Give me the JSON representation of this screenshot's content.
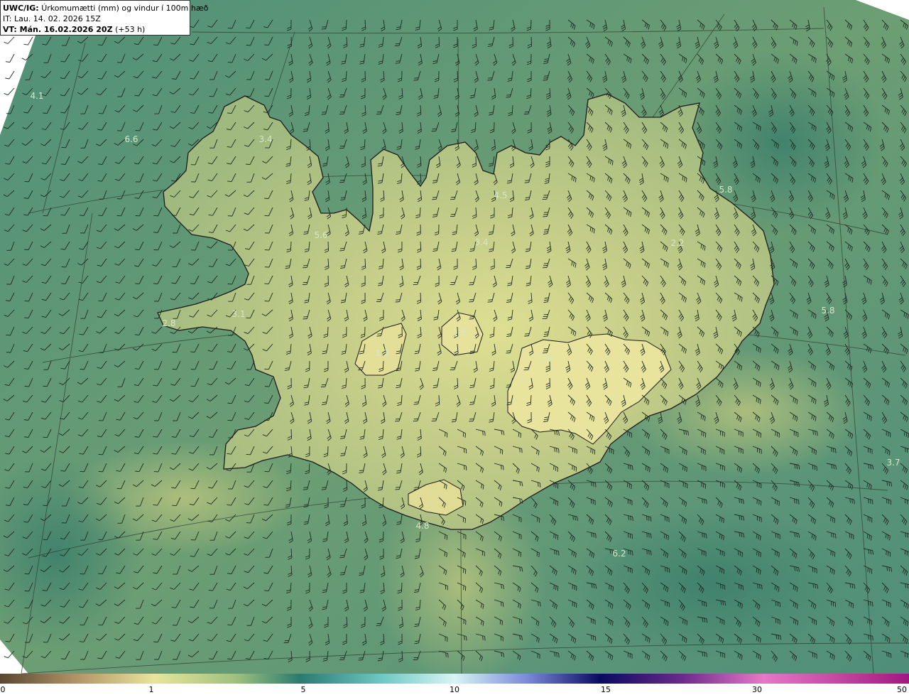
{
  "header": {
    "model": "UWC/IG:",
    "title": "Úrkomumætti (mm) og vindur í 100m hæð",
    "initial_time": "IT: Lau. 14. 02. 2026 15Z",
    "valid_label": "VT: Mán. 16.02.2026 20Z",
    "lead": "(+53 h)"
  },
  "map_labels": [
    {
      "id": "nw-sea-1",
      "text": "4.1"
    },
    {
      "id": "nw-sea-2",
      "text": "6.6"
    },
    {
      "id": "westfjords",
      "text": "3.4"
    },
    {
      "id": "north-west",
      "text": "5.6"
    },
    {
      "id": "north",
      "text": "4.5"
    },
    {
      "id": "north-central",
      "text": "3.4"
    },
    {
      "id": "east-fjords",
      "text": "2.2"
    },
    {
      "id": "ne-coast",
      "text": "5.8"
    },
    {
      "id": "east-sea",
      "text": "5.8"
    },
    {
      "id": "snaefellsnes",
      "text": "3.1"
    },
    {
      "id": "west-tip",
      "text": "2.8"
    },
    {
      "id": "langjokull",
      "text": "1.3"
    },
    {
      "id": "hofsjokull",
      "text": "1.5"
    },
    {
      "id": "vatnajokull",
      "text": "1.0"
    },
    {
      "id": "south-coast",
      "text": "4.8"
    },
    {
      "id": "south-sea",
      "text": "6.2"
    },
    {
      "id": "se-sea",
      "text": "3.7"
    }
  ],
  "colorbar": {
    "ticks": [
      "0",
      "1",
      "5",
      "10",
      "15",
      "30",
      "50"
    ],
    "colors": [
      "#5a4632",
      "#b59a6a",
      "#e8e59a",
      "#6ea28a",
      "#2a7a70",
      "#7ad8d8",
      "#d0f0f0",
      "#2a2aa0",
      "#0a0a60",
      "#6a2a8a",
      "#e070c0",
      "#b02080"
    ]
  }
}
